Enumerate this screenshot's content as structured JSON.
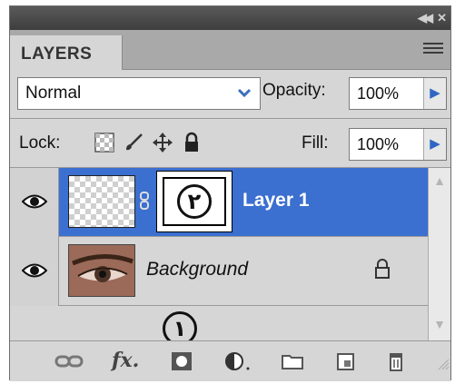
{
  "panel": {
    "tab_label": "LAYERS"
  },
  "blend_mode": {
    "selected": "Normal"
  },
  "opacity": {
    "label": "Opacity:",
    "value": "100%"
  },
  "lock": {
    "label": "Lock:",
    "icons": [
      "lock-transparent-pixels-icon",
      "lock-image-pixels-icon",
      "lock-position-icon",
      "lock-all-icon"
    ]
  },
  "fill": {
    "label": "Fill:",
    "value": "100%"
  },
  "layers": [
    {
      "name": "Layer 1",
      "selected": true,
      "has_mask": true,
      "annotation": "٢"
    },
    {
      "name": "Background",
      "selected": false,
      "locked": true
    }
  ],
  "annotations": {
    "add_mask_badge": "١"
  },
  "bottom_icons": [
    "link-layers-icon",
    "fx-icon",
    "add-mask-icon",
    "adjustment-layer-icon",
    "new-group-icon",
    "new-layer-icon",
    "delete-icon"
  ],
  "colors": {
    "selection": "#3b6fd0",
    "panel_bg": "#d6d6d6",
    "titlebar": "#4a4a4a"
  }
}
